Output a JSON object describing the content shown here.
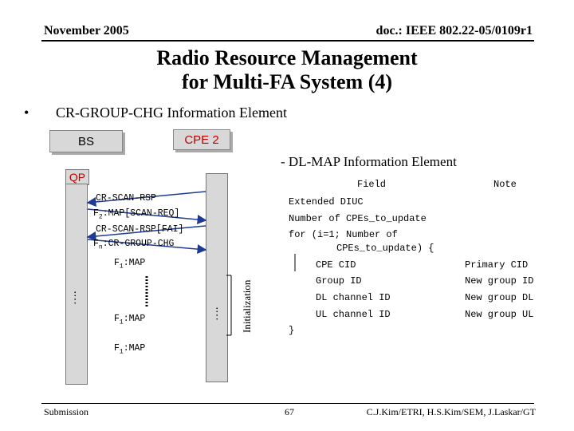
{
  "header": {
    "date": "November 2005",
    "doc": "doc.: IEEE 802.22-05/0109r1"
  },
  "title": {
    "line1": "Radio Resource Management",
    "line2": "for Multi-FA System (4)"
  },
  "bullet": {
    "text": "CR-GROUP-CHG Information Element"
  },
  "diagram": {
    "bs_label": "BS",
    "cpe_label": "CPE 2",
    "qp_label": "QP",
    "msgs": {
      "m1": "CR-SCAN-RSP",
      "m2": "F",
      "m2sub": "2",
      "m2rest": ":MAP[SCAN-REQ]",
      "m3": "CR-SCAN-RSP[FAI]",
      "m4": "F",
      "m4sub": "n",
      "m4rest": ":CR-GROUP-CHG",
      "m5": "F",
      "m5sub": "1",
      "m5rest": ":MAP",
      "m6": "F",
      "m6sub": "1",
      "m6rest": ":MAP",
      "m7": "F",
      "m7sub": "1",
      "m7rest": ":MAP"
    },
    "dots": "….",
    "init_label": "Initialization"
  },
  "dlmap": {
    "heading": "- DL-MAP Information Element",
    "col_field": "Field",
    "col_note": "Note",
    "rows": [
      {
        "field": "Extended DIUC",
        "note": ""
      },
      {
        "field": "Number of CPEs_to_update",
        "note": ""
      },
      {
        "field": "for (i=1; Number of",
        "note": ""
      },
      {
        "field": "CPEs_to_update) {",
        "note": ""
      },
      {
        "field": "CPE CID",
        "note": "Primary CID"
      },
      {
        "field": "Group ID",
        "note": "New group ID"
      },
      {
        "field": "DL channel ID",
        "note": "New group DL"
      },
      {
        "field": "UL channel ID",
        "note": "New group UL"
      },
      {
        "field": "}",
        "note": ""
      }
    ]
  },
  "footer": {
    "left": "Submission",
    "page": "67",
    "authors": "C.J.Kim/ETRI, H.S.Kim/SEM, J.Laskar/GT"
  }
}
